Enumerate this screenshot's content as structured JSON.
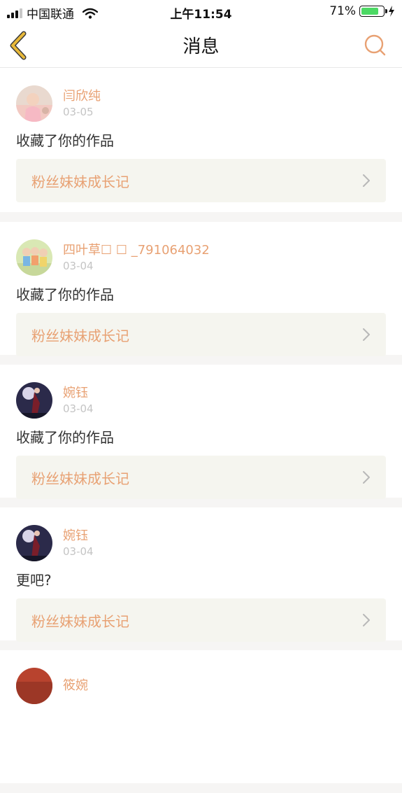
{
  "status_bar": {
    "carrier": "中国联通",
    "time": "上午11:54",
    "battery": "71%",
    "battery_level": 0.71
  },
  "header": {
    "title": "消息",
    "back_icon": "chevron-left-icon",
    "search_icon": "search-icon"
  },
  "colors": {
    "accent": "#e8a173",
    "back_chevron": "#e8b93a"
  },
  "messages": [
    {
      "name": "闫欣纯",
      "date": "03-05",
      "text": "收藏了你的作品",
      "ref": "粉丝妹妹成长记"
    },
    {
      "name": "四叶草☐ ☐ _791064032",
      "date": "03-04",
      "text": "收藏了你的作品",
      "ref": "粉丝妹妹成长记"
    },
    {
      "name": "婉钰",
      "date": "03-04",
      "text": "收藏了你的作品",
      "ref": "粉丝妹妹成长记"
    },
    {
      "name": "婉钰",
      "date": "03-04",
      "text": "更吧?",
      "ref": "粉丝妹妹成长记"
    },
    {
      "name": "筱婉",
      "date": "",
      "text": "",
      "ref": ""
    }
  ]
}
